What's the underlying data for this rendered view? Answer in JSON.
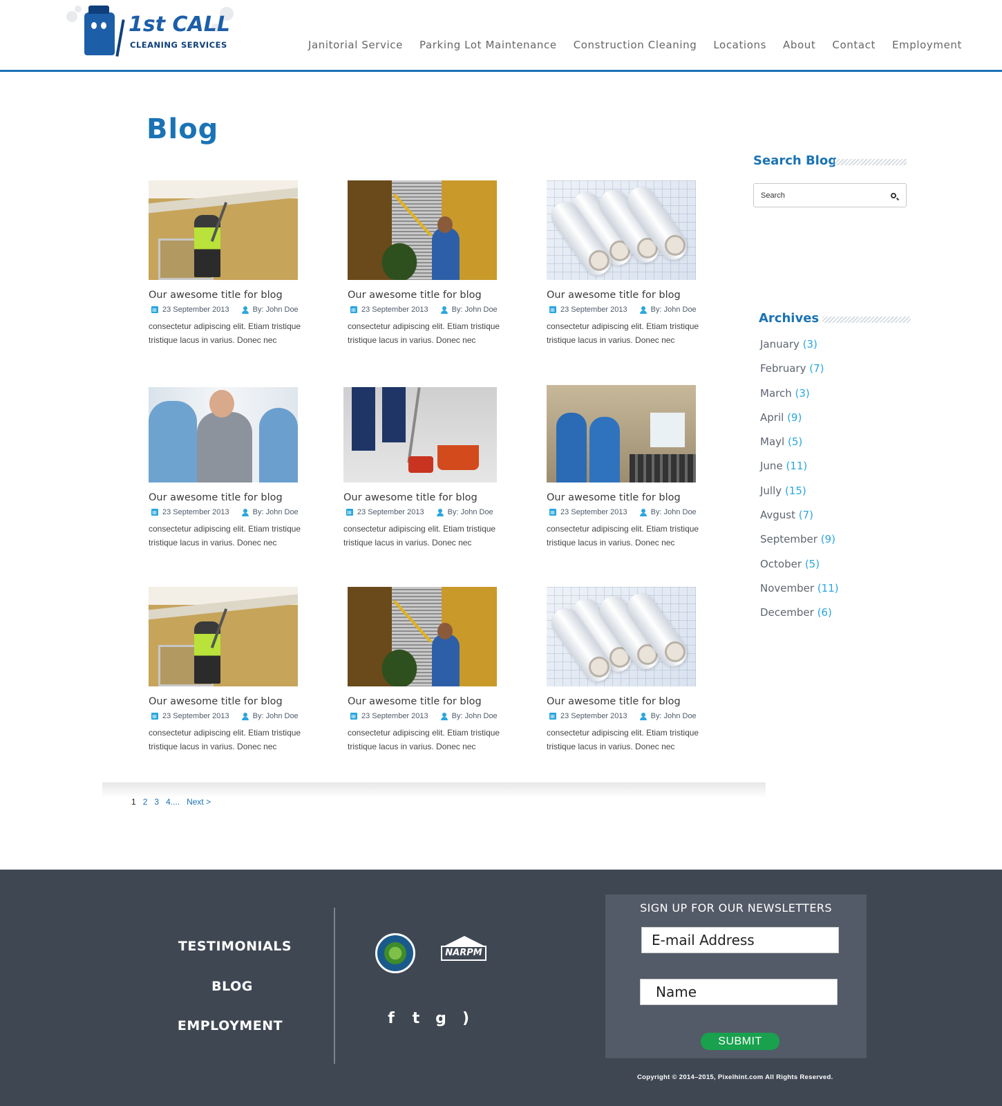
{
  "brand": {
    "name_main": "1st CALL",
    "name_sub": "CLEANING SERVICES"
  },
  "nav": [
    "Janitorial Service",
    "Parking Lot Maintenance",
    "Construction Cleaning",
    "Locations",
    "About",
    "Contact",
    "Employment"
  ],
  "page_title": "Blog",
  "posts": [
    {
      "title": "Our awesome title for blog",
      "date": "23 September 2013",
      "author": "By: John Doe",
      "excerpt": "consectetur adipiscing elit. Etiam tristique tristique lacus in varius. Donec nec",
      "image": "pressure-washing"
    },
    {
      "title": "Our awesome title for blog",
      "date": "23 September 2013",
      "author": "By: John Doe",
      "excerpt": "consectetur adipiscing elit. Etiam tristique tristique lacus in varius. Donec nec",
      "image": "dusting-blinds"
    },
    {
      "title": "Our awesome title for blog",
      "date": "23 September 2013",
      "author": "By: John Doe",
      "excerpt": "consectetur adipiscing elit. Etiam tristique tristique lacus in varius. Donec nec",
      "image": "blueprints"
    },
    {
      "title": "Our awesome title for blog",
      "date": "23 September 2013",
      "author": "By: John Doe",
      "excerpt": "consectetur adipiscing elit. Etiam tristique tristique lacus in varius. Donec nec",
      "image": "handshake"
    },
    {
      "title": "Our awesome title for blog",
      "date": "23 September 2013",
      "author": "By: John Doe",
      "excerpt": "consectetur adipiscing elit. Etiam tristique tristique lacus in varius. Donec nec",
      "image": "sweeping"
    },
    {
      "title": "Our awesome title for blog",
      "date": "23 September 2013",
      "author": "By: John Doe",
      "excerpt": "consectetur adipiscing elit. Etiam tristique tristique lacus in varius. Donec nec",
      "image": "gym-team"
    },
    {
      "title": "Our awesome title for blog",
      "date": "23 September 2013",
      "author": "By: John Doe",
      "excerpt": "consectetur adipiscing elit. Etiam tristique tristique lacus in varius. Donec nec",
      "image": "pressure-washing"
    },
    {
      "title": "Our awesome title for blog",
      "date": "23 September 2013",
      "author": "By: John Doe",
      "excerpt": "consectetur adipiscing elit. Etiam tristique tristique lacus in varius. Donec nec",
      "image": "dusting-blinds"
    },
    {
      "title": "Our awesome title for blog",
      "date": "23 September 2013",
      "author": "By: John Doe",
      "excerpt": "consectetur adipiscing elit. Etiam tristique tristique lacus in varius. Donec nec",
      "image": "blueprints"
    }
  ],
  "pagination": {
    "current": "1",
    "pages": [
      "2",
      "3",
      "4...."
    ],
    "next": "Next >"
  },
  "sidebar": {
    "search_heading": "Search Blog",
    "search_placeholder": "Search",
    "archives_heading": "Archives",
    "archives": [
      {
        "month": "January",
        "count": "(3)"
      },
      {
        "month": "February",
        "count": "(7)"
      },
      {
        "month": "March",
        "count": "(3)"
      },
      {
        "month": "April",
        "count": "(9)"
      },
      {
        "month": "Mayl",
        "count": "(5)"
      },
      {
        "month": "June",
        "count": "(11)"
      },
      {
        "month": "Jully",
        "count": "(15)"
      },
      {
        "month": "Avgust",
        "count": "(7)"
      },
      {
        "month": "September",
        "count": "(9)"
      },
      {
        "month": "October",
        "count": "(5)"
      },
      {
        "month": "November",
        "count": "(11)"
      },
      {
        "month": "December",
        "count": "(6)"
      }
    ]
  },
  "footer": {
    "links": [
      "TESTIMONIALS",
      "BLOG",
      "EMPLOYMENT"
    ],
    "badge_text": "NARPM",
    "socials": [
      {
        "icon": "facebook-icon",
        "glyph": "f"
      },
      {
        "icon": "twitter-icon",
        "glyph": "t"
      },
      {
        "icon": "google-plus-icon",
        "glyph": "g"
      },
      {
        "icon": "rss-icon",
        "glyph": ")"
      }
    ],
    "newsletter": {
      "heading": "SIGN UP FOR OUR NEWSLETTERS",
      "email_placeholder": "E-mail Address",
      "name_placeholder": "Name",
      "submit": "SUBMIT"
    },
    "copyright": "Copyright © 2014–2015, Pixelhint.com All Rights Reserved."
  },
  "colors": {
    "accent": "#1a73b5",
    "footer": "#3f4753",
    "newsletter": "#535b68",
    "submit": "#19a14e",
    "count": "#2aa6de"
  }
}
